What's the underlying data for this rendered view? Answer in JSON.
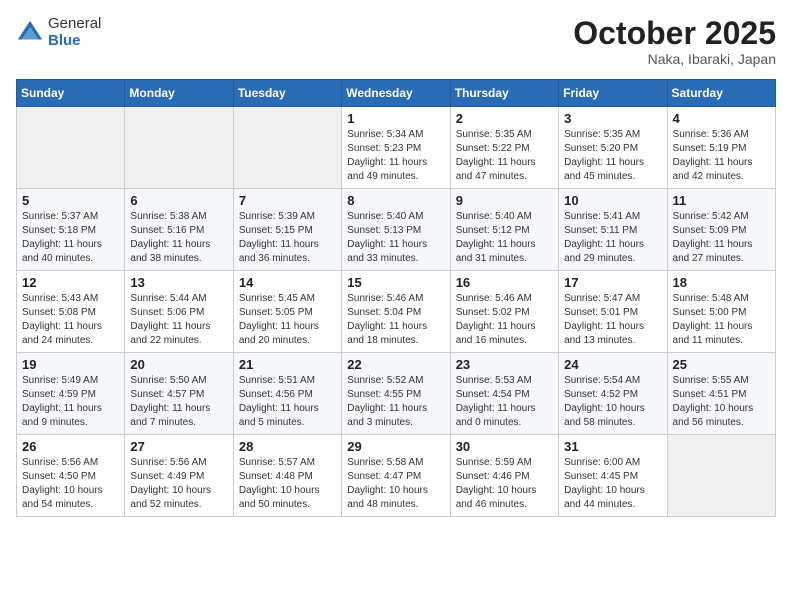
{
  "logo": {
    "general": "General",
    "blue": "Blue"
  },
  "title": {
    "month": "October 2025",
    "location": "Naka, Ibaraki, Japan"
  },
  "weekdays": [
    "Sunday",
    "Monday",
    "Tuesday",
    "Wednesday",
    "Thursday",
    "Friday",
    "Saturday"
  ],
  "weeks": [
    [
      {
        "day": "",
        "info": ""
      },
      {
        "day": "",
        "info": ""
      },
      {
        "day": "",
        "info": ""
      },
      {
        "day": "1",
        "info": "Sunrise: 5:34 AM\nSunset: 5:23 PM\nDaylight: 11 hours\nand 49 minutes."
      },
      {
        "day": "2",
        "info": "Sunrise: 5:35 AM\nSunset: 5:22 PM\nDaylight: 11 hours\nand 47 minutes."
      },
      {
        "day": "3",
        "info": "Sunrise: 5:35 AM\nSunset: 5:20 PM\nDaylight: 11 hours\nand 45 minutes."
      },
      {
        "day": "4",
        "info": "Sunrise: 5:36 AM\nSunset: 5:19 PM\nDaylight: 11 hours\nand 42 minutes."
      }
    ],
    [
      {
        "day": "5",
        "info": "Sunrise: 5:37 AM\nSunset: 5:18 PM\nDaylight: 11 hours\nand 40 minutes."
      },
      {
        "day": "6",
        "info": "Sunrise: 5:38 AM\nSunset: 5:16 PM\nDaylight: 11 hours\nand 38 minutes."
      },
      {
        "day": "7",
        "info": "Sunrise: 5:39 AM\nSunset: 5:15 PM\nDaylight: 11 hours\nand 36 minutes."
      },
      {
        "day": "8",
        "info": "Sunrise: 5:40 AM\nSunset: 5:13 PM\nDaylight: 11 hours\nand 33 minutes."
      },
      {
        "day": "9",
        "info": "Sunrise: 5:40 AM\nSunset: 5:12 PM\nDaylight: 11 hours\nand 31 minutes."
      },
      {
        "day": "10",
        "info": "Sunrise: 5:41 AM\nSunset: 5:11 PM\nDaylight: 11 hours\nand 29 minutes."
      },
      {
        "day": "11",
        "info": "Sunrise: 5:42 AM\nSunset: 5:09 PM\nDaylight: 11 hours\nand 27 minutes."
      }
    ],
    [
      {
        "day": "12",
        "info": "Sunrise: 5:43 AM\nSunset: 5:08 PM\nDaylight: 11 hours\nand 24 minutes."
      },
      {
        "day": "13",
        "info": "Sunrise: 5:44 AM\nSunset: 5:06 PM\nDaylight: 11 hours\nand 22 minutes."
      },
      {
        "day": "14",
        "info": "Sunrise: 5:45 AM\nSunset: 5:05 PM\nDaylight: 11 hours\nand 20 minutes."
      },
      {
        "day": "15",
        "info": "Sunrise: 5:46 AM\nSunset: 5:04 PM\nDaylight: 11 hours\nand 18 minutes."
      },
      {
        "day": "16",
        "info": "Sunrise: 5:46 AM\nSunset: 5:02 PM\nDaylight: 11 hours\nand 16 minutes."
      },
      {
        "day": "17",
        "info": "Sunrise: 5:47 AM\nSunset: 5:01 PM\nDaylight: 11 hours\nand 13 minutes."
      },
      {
        "day": "18",
        "info": "Sunrise: 5:48 AM\nSunset: 5:00 PM\nDaylight: 11 hours\nand 11 minutes."
      }
    ],
    [
      {
        "day": "19",
        "info": "Sunrise: 5:49 AM\nSunset: 4:59 PM\nDaylight: 11 hours\nand 9 minutes."
      },
      {
        "day": "20",
        "info": "Sunrise: 5:50 AM\nSunset: 4:57 PM\nDaylight: 11 hours\nand 7 minutes."
      },
      {
        "day": "21",
        "info": "Sunrise: 5:51 AM\nSunset: 4:56 PM\nDaylight: 11 hours\nand 5 minutes."
      },
      {
        "day": "22",
        "info": "Sunrise: 5:52 AM\nSunset: 4:55 PM\nDaylight: 11 hours\nand 3 minutes."
      },
      {
        "day": "23",
        "info": "Sunrise: 5:53 AM\nSunset: 4:54 PM\nDaylight: 11 hours\nand 0 minutes."
      },
      {
        "day": "24",
        "info": "Sunrise: 5:54 AM\nSunset: 4:52 PM\nDaylight: 10 hours\nand 58 minutes."
      },
      {
        "day": "25",
        "info": "Sunrise: 5:55 AM\nSunset: 4:51 PM\nDaylight: 10 hours\nand 56 minutes."
      }
    ],
    [
      {
        "day": "26",
        "info": "Sunrise: 5:56 AM\nSunset: 4:50 PM\nDaylight: 10 hours\nand 54 minutes."
      },
      {
        "day": "27",
        "info": "Sunrise: 5:56 AM\nSunset: 4:49 PM\nDaylight: 10 hours\nand 52 minutes."
      },
      {
        "day": "28",
        "info": "Sunrise: 5:57 AM\nSunset: 4:48 PM\nDaylight: 10 hours\nand 50 minutes."
      },
      {
        "day": "29",
        "info": "Sunrise: 5:58 AM\nSunset: 4:47 PM\nDaylight: 10 hours\nand 48 minutes."
      },
      {
        "day": "30",
        "info": "Sunrise: 5:59 AM\nSunset: 4:46 PM\nDaylight: 10 hours\nand 46 minutes."
      },
      {
        "day": "31",
        "info": "Sunrise: 6:00 AM\nSunset: 4:45 PM\nDaylight: 10 hours\nand 44 minutes."
      },
      {
        "day": "",
        "info": ""
      }
    ]
  ]
}
